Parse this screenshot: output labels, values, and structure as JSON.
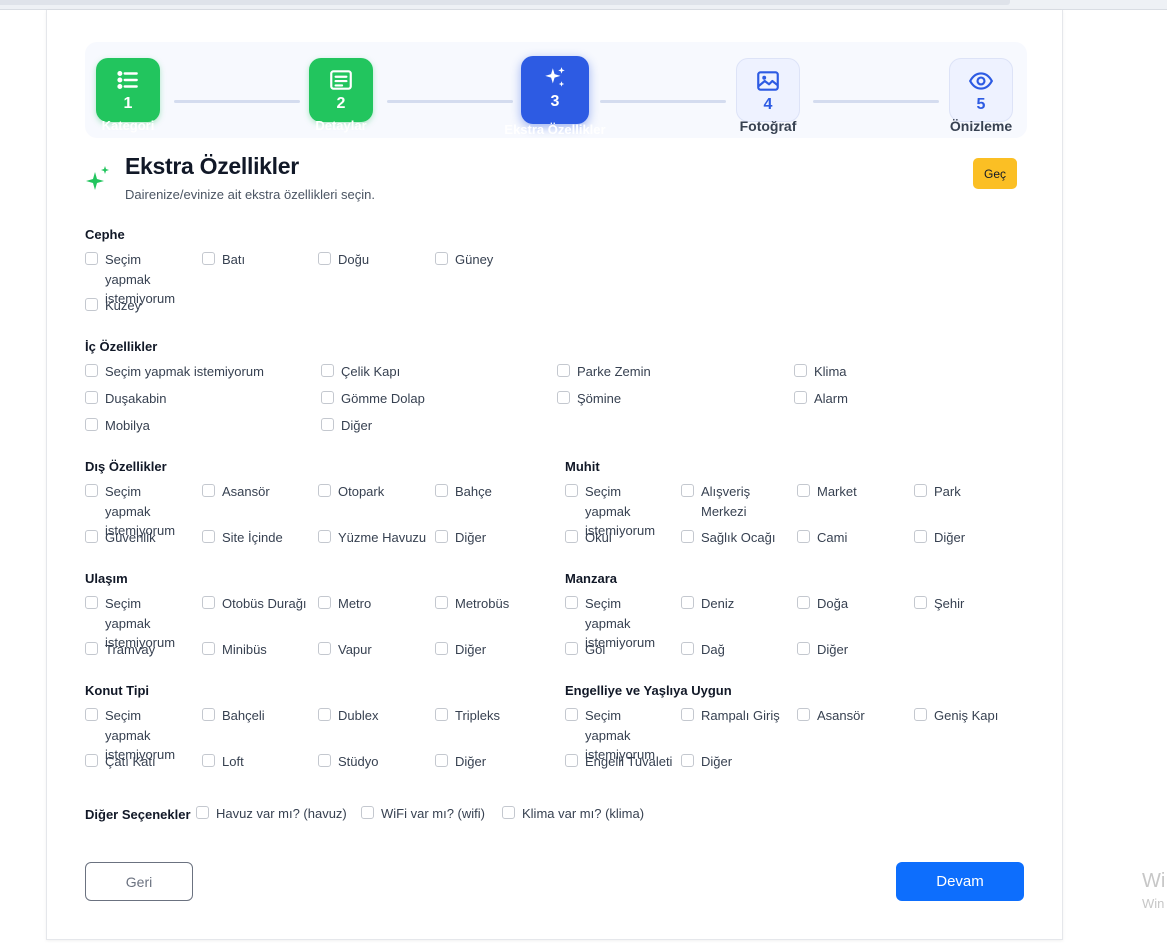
{
  "steps": [
    {
      "num": "1",
      "label": "Kategori",
      "state": "done",
      "icon": "list-icon"
    },
    {
      "num": "2",
      "label": "Detaylar",
      "state": "done",
      "icon": "document-icon"
    },
    {
      "num": "3",
      "label": "Ekstra Özellikler",
      "state": "active",
      "icon": "sparkles-icon"
    },
    {
      "num": "4",
      "label": "Fotoğraf",
      "state": "todo",
      "icon": "image-icon"
    },
    {
      "num": "5",
      "label": "Önizleme",
      "state": "todo",
      "icon": "eye-icon"
    }
  ],
  "header": {
    "title": "Ekstra Özellikler",
    "subtitle": "Dairenize/evinize ait ekstra özellikleri seçin.",
    "skip_label": "Geç"
  },
  "sections": {
    "cephe": {
      "title": "Cephe",
      "options": [
        "Seçim yapmak istemiyorum",
        "Batı",
        "Doğu",
        "Güney",
        "Kuzey"
      ]
    },
    "ic": {
      "title": "İç Özellikler",
      "options": [
        "Seçim yapmak istemiyorum",
        "Çelik Kapı",
        "Parke Zemin",
        "Klima",
        "Duşakabin",
        "Gömme Dolap",
        "Şömine",
        "Alarm",
        "Mobilya",
        "Diğer"
      ]
    },
    "dis": {
      "title": "Dış Özellikler",
      "options": [
        "Seçim yapmak istemiyorum",
        "Asansör",
        "Otopark",
        "Bahçe",
        "Güvenlik",
        "Site İçinde",
        "Yüzme Havuzu",
        "Diğer"
      ]
    },
    "muhit": {
      "title": "Muhit",
      "options": [
        "Seçim yapmak istemiyorum",
        "Alışveriş Merkezi",
        "Market",
        "Park",
        "Okul",
        "Sağlık Ocağı",
        "Cami",
        "Diğer"
      ]
    },
    "ulasim": {
      "title": "Ulaşım",
      "options": [
        "Seçim yapmak istemiyorum",
        "Otobüs Durağı",
        "Metro",
        "Metrobüs",
        "Tramvay",
        "Minibüs",
        "Vapur",
        "Diğer"
      ]
    },
    "manzara": {
      "title": "Manzara",
      "options": [
        "Seçim yapmak istemiyorum",
        "Deniz",
        "Doğa",
        "Şehir",
        "Göl",
        "Dağ",
        "Diğer"
      ]
    },
    "konut": {
      "title": "Konut Tipi",
      "options": [
        "Seçim yapmak istemiyorum",
        "Bahçeli",
        "Dublex",
        "Tripleks",
        "Çatı Katı",
        "Loft",
        "Stüdyo",
        "Diğer"
      ]
    },
    "engelli": {
      "title": "Engelliye ve Yaşlıya Uygun",
      "options": [
        "Seçim yapmak istemiyorum",
        "Rampalı Giriş",
        "Asansör",
        "Geniş Kapı",
        "Engelli Tuvaleti",
        "Diğer"
      ]
    },
    "diger": {
      "title": "Diğer Seçenekler",
      "options": [
        "Havuz var mı? (havuz)",
        "WiFi var mı? (wifi)",
        "Klima var mı? (klima)"
      ]
    }
  },
  "footer": {
    "back_label": "Geri",
    "next_label": "Devam"
  },
  "watermark": {
    "line1": "Wi",
    "line2": "Win"
  },
  "colors": {
    "done": "#22c55e",
    "active": "#2d5be3",
    "skip": "#fbbf24",
    "primary": "#0d6efd"
  }
}
